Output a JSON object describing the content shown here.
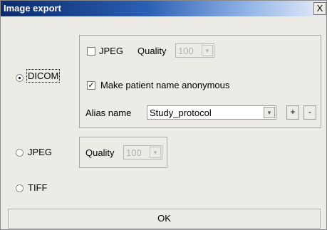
{
  "window": {
    "title": "Image export",
    "close_glyph": "X"
  },
  "options": {
    "dicom_label": "DICOM",
    "jpeg_label": "JPEG",
    "tiff_label": "TIFF",
    "selected": "DICOM"
  },
  "dicom_group": {
    "jpeg_checkbox_label": "JPEG",
    "jpeg_checked": false,
    "quality_label": "Quality",
    "quality_value": "100",
    "anonymous_label": "Make patient name anonymous",
    "anonymous_checked": true,
    "alias_label": "Alias name",
    "alias_value": "Study_protocol",
    "add_label": "+",
    "remove_label": "-"
  },
  "jpeg_group": {
    "quality_label": "Quality",
    "quality_value": "100"
  },
  "footer": {
    "ok_label": "OK"
  }
}
